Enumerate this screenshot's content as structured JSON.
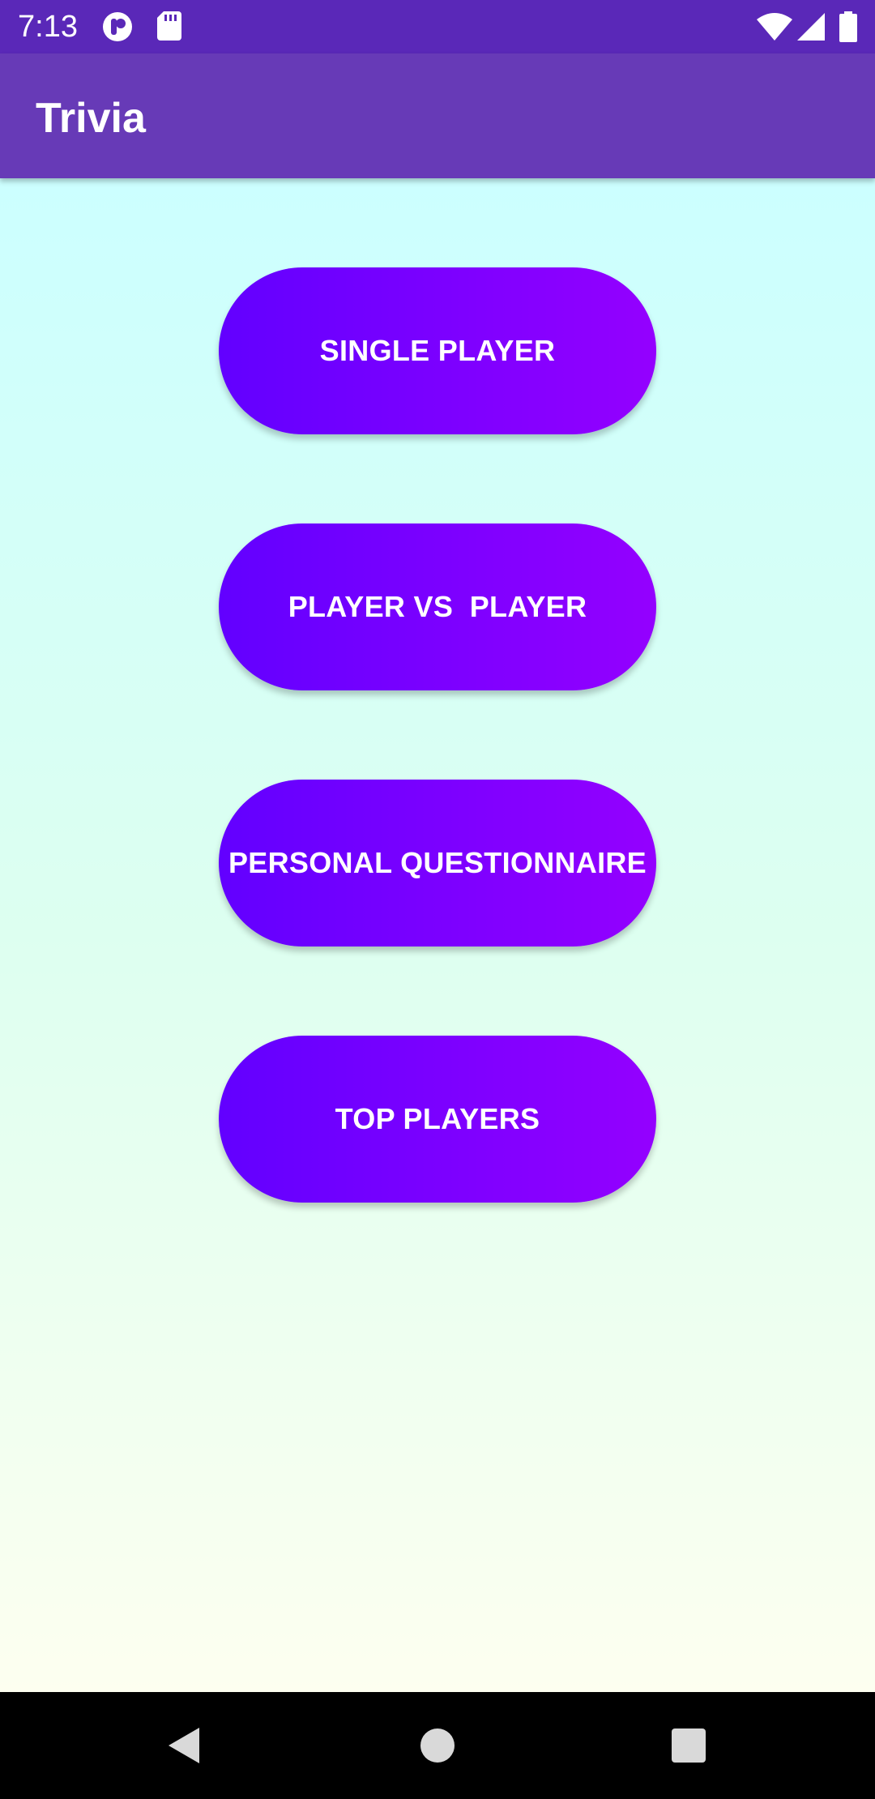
{
  "status_bar": {
    "time": "7:13",
    "icons": [
      "app-notification-icon",
      "sd-card-icon",
      "wifi-icon",
      "signal-icon",
      "battery-icon"
    ]
  },
  "app_bar": {
    "title": "Trivia"
  },
  "menu": {
    "buttons": [
      {
        "label": "SINGLE PLAYER"
      },
      {
        "label": "PLAYER VS  PLAYER"
      },
      {
        "label": "PERSONAL QUESTIONNAIRE"
      },
      {
        "label": "TOP PLAYERS"
      }
    ]
  },
  "nav_bar": {
    "icons": [
      "back-icon",
      "home-icon",
      "recents-icon"
    ]
  },
  "colors": {
    "status_bar": "#5a28b8",
    "app_bar": "#673ab7",
    "button_gradient_start": "#6200ff",
    "button_gradient_end": "#9400ff",
    "background_top": "#ccffff",
    "background_bottom": "#fdfff0"
  }
}
